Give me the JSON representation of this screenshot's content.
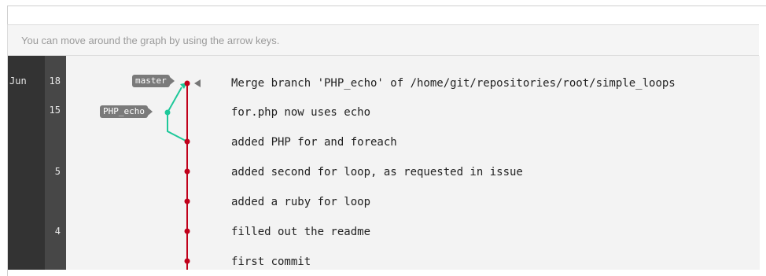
{
  "hint": "You can move around the graph by using the arrow keys.",
  "dates": [
    {
      "month": "Jun",
      "day": "18"
    },
    {
      "month": "",
      "day": "15"
    },
    {
      "month": "",
      "day": "5"
    },
    {
      "month": "",
      "day": "4"
    }
  ],
  "refs": {
    "master": "master",
    "php_echo": "PHP_echo"
  },
  "commits": [
    {
      "message": "Merge branch 'PHP_echo' of /home/git/repositories/root/simple_loops"
    },
    {
      "message": "for.php now uses echo"
    },
    {
      "message": "added PHP for and foreach"
    },
    {
      "message": "added second for loop, as requested in issue"
    },
    {
      "message": "added a ruby for loop"
    },
    {
      "message": "filled out the readme"
    },
    {
      "message": "first commit"
    }
  ],
  "colors": {
    "master_branch": "#c0001a",
    "php_echo_branch": "#1ec89a",
    "date_sidebar": "#333333"
  }
}
